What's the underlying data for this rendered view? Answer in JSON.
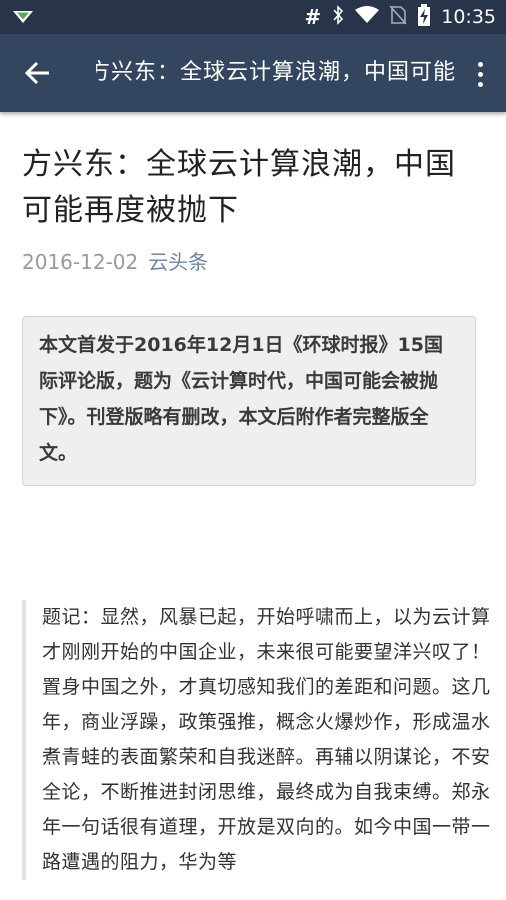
{
  "status_bar": {
    "time": "10:35",
    "icons": [
      "notification-icon",
      "hash-icon",
      "bluetooth-icon",
      "wifi-icon",
      "no-sim-icon",
      "battery-charging-icon"
    ]
  },
  "app_bar": {
    "title": "方兴东：全球云计算浪潮，中国可能再度被抛下",
    "back_icon": "arrow-back-icon",
    "menu_icon": "more-vert-icon"
  },
  "article": {
    "headline": "方兴东：全球云计算浪潮，中国可能再度被抛下",
    "date": "2016-12-02",
    "source": "云头条",
    "notice": "本文首发于2016年12月1日《环球时报》15国际评论版，题为《云计算时代，中国可能会被抛下》。刊登版略有删改，本文后附作者完整版全文。",
    "quote": "题记：显然，风暴已起，开始呼啸而上，以为云计算才刚刚开始的中国企业，未来很可能要望洋兴叹了！置身中国之外，才真切感知我们的差距和问题。这几年，商业浮躁，政策强推，概念火爆炒作，形成温水煮青蛙的表面繁荣和自我迷醉。再辅以阴谋论，不安全论，不断推进封闭思维，最终成为自我束缚。郑永年一句话很有道理，开放是双向的。如今中国一带一路遭遇的阻力，华为等"
  },
  "colors": {
    "status_bar": "#273449",
    "app_bar": "#34465f",
    "source_link": "#6b86a8"
  }
}
